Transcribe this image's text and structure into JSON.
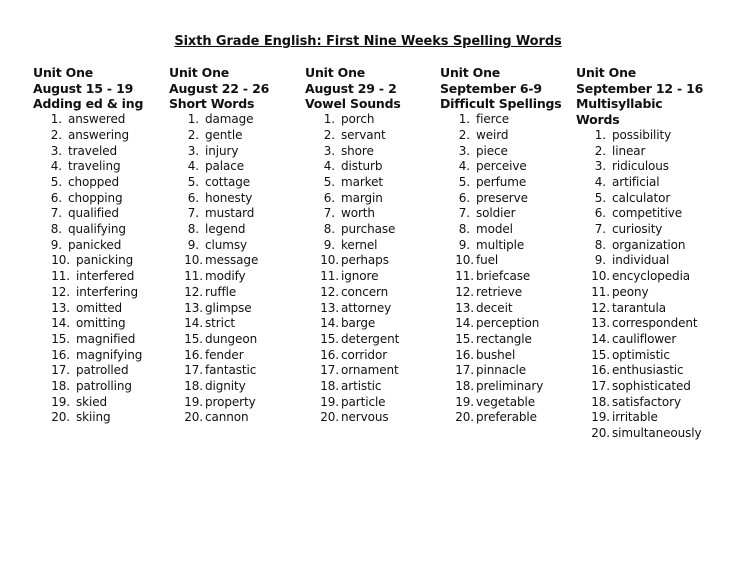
{
  "title": "Sixth Grade English: First Nine Weeks Spelling Words",
  "units": [
    {
      "unit": "Unit One",
      "dates": "August 15 - 19",
      "topic": [
        "Adding ed & ing"
      ],
      "words": [
        "answered",
        "answering",
        "traveled",
        "traveling",
        "chopped",
        "chopping",
        "qualified",
        "qualifying",
        "panicked",
        "panicking",
        "interfered",
        "interfering",
        "omitted",
        "omitting",
        "magnified",
        "magnifying",
        "patrolled",
        "patrolling",
        "skied",
        "skiing"
      ]
    },
    {
      "unit": "Unit One",
      "dates": "August 22 - 26",
      "topic": [
        "Short Words"
      ],
      "words": [
        "damage",
        "gentle",
        "injury",
        "palace",
        "cottage",
        "honesty",
        "mustard",
        "legend",
        "clumsy",
        "message",
        "modify",
        "ruffle",
        "glimpse",
        "strict",
        "dungeon",
        "fender",
        "fantastic",
        "dignity",
        "property",
        "cannon"
      ]
    },
    {
      "unit": "Unit One",
      "dates": "August 29 - 2",
      "topic": [
        "Vowel Sounds"
      ],
      "words": [
        "porch",
        "servant",
        "shore",
        "disturb",
        "market",
        "margin",
        "worth",
        "purchase",
        "kernel",
        "perhaps",
        "ignore",
        "concern",
        "attorney",
        "barge",
        "detergent",
        "corridor",
        "ornament",
        "artistic",
        "particle",
        "nervous"
      ]
    },
    {
      "unit": "Unit One",
      "dates": "September 6-9",
      "topic": [
        "Difficult Spellings"
      ],
      "words": [
        "fierce",
        "weird",
        "piece",
        "perceive",
        "perfume",
        "preserve",
        "soldier",
        "model",
        "multiple",
        "fuel",
        "briefcase",
        "retrieve",
        "deceit",
        "perception",
        "rectangle",
        "bushel",
        "pinnacle",
        "preliminary",
        "vegetable",
        "preferable"
      ]
    },
    {
      "unit": "Unit One",
      "dates": "September 12 - 16",
      "topic": [
        "Multisyllabic",
        "Words"
      ],
      "words": [
        "possibility",
        "linear",
        "ridiculous",
        "artificial",
        "calculator",
        "competitive",
        "curiosity",
        "organization",
        "individual",
        "encyclopedia",
        "peony",
        "tarantula",
        "correspondent",
        "cauliflower",
        "optimistic",
        "enthusiastic",
        "sophisticated",
        "satisfactory",
        "irritable",
        "simultaneously"
      ]
    }
  ]
}
